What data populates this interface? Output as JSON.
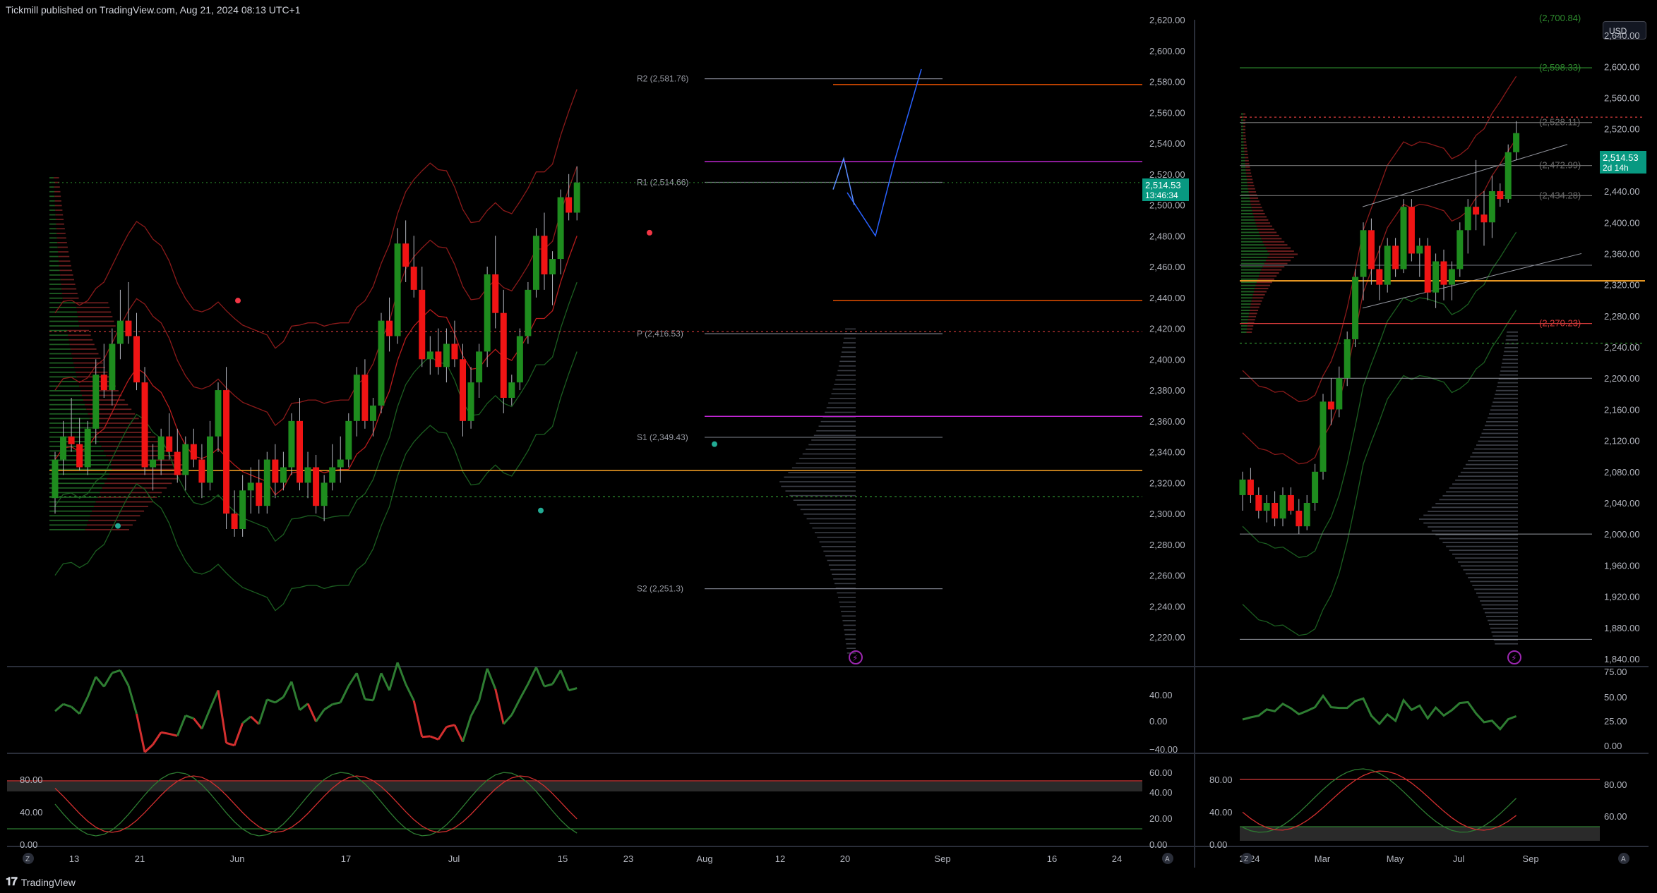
{
  "header": {
    "published": "Tickmill published on TradingView.com, Aug 21, 2024 08:13 UTC+1"
  },
  "footer": {
    "brand": "TradingView"
  },
  "currency_button": "USD",
  "left_chart": {
    "price_ticks": [
      "2,620.00",
      "2,600.00",
      "2,580.00",
      "2,560.00",
      "2,540.00",
      "2,520.00",
      "2,500.00",
      "2,480.00",
      "2,460.00",
      "2,440.00",
      "2,420.00",
      "2,400.00",
      "2,380.00",
      "2,360.00",
      "2,340.00",
      "2,320.00",
      "2,300.00",
      "2,280.00",
      "2,260.00",
      "2,240.00",
      "2,220.00"
    ],
    "price_label": "2,514.53",
    "countdown": "13:46:34",
    "pivots": [
      {
        "label": "R2 (2,581.76)",
        "price": 2581.76
      },
      {
        "label": "R1 (2,514.66)",
        "price": 2514.66
      },
      {
        "label": "P (2,416.53)",
        "price": 2416.53
      },
      {
        "label": "S1 (2,349.43)",
        "price": 2349.43
      },
      {
        "label": "S2 (2,251.3)",
        "price": 2251.3
      }
    ],
    "date_ticks": [
      "13",
      "21",
      "Jun",
      "17",
      "Jul",
      "15",
      "23",
      "Aug",
      "12",
      "20",
      "Sep",
      "16",
      "24"
    ],
    "rsi_ticks": [
      "40.00",
      "0.00",
      "−40.00"
    ],
    "stoch_left_ticks": [
      "80.00",
      "40.00",
      "0.00"
    ],
    "stoch_right_ticks": [
      "60.00",
      "40.00",
      "20.00",
      "0.00"
    ],
    "candles": [
      [
        2310,
        2340,
        2300,
        2335
      ],
      [
        2335,
        2360,
        2325,
        2350
      ],
      [
        2350,
        2375,
        2340,
        2345
      ],
      [
        2345,
        2362,
        2328,
        2330
      ],
      [
        2330,
        2360,
        2325,
        2355
      ],
      [
        2355,
        2400,
        2345,
        2390
      ],
      [
        2390,
        2410,
        2375,
        2380
      ],
      [
        2380,
        2420,
        2370,
        2410
      ],
      [
        2410,
        2445,
        2400,
        2425
      ],
      [
        2425,
        2450,
        2410,
        2415
      ],
      [
        2415,
        2430,
        2380,
        2385
      ],
      [
        2385,
        2395,
        2325,
        2330
      ],
      [
        2330,
        2345,
        2315,
        2335
      ],
      [
        2335,
        2355,
        2325,
        2350
      ],
      [
        2350,
        2365,
        2335,
        2340
      ],
      [
        2340,
        2355,
        2320,
        2325
      ],
      [
        2325,
        2350,
        2315,
        2345
      ],
      [
        2345,
        2355,
        2330,
        2335
      ],
      [
        2335,
        2345,
        2310,
        2320
      ],
      [
        2320,
        2360,
        2315,
        2350
      ],
      [
        2350,
        2385,
        2340,
        2380
      ],
      [
        2380,
        2395,
        2290,
        2300
      ],
      [
        2300,
        2315,
        2285,
        2290
      ],
      [
        2290,
        2325,
        2285,
        2315
      ],
      [
        2315,
        2330,
        2300,
        2320
      ],
      [
        2320,
        2335,
        2300,
        2305
      ],
      [
        2305,
        2340,
        2300,
        2335
      ],
      [
        2335,
        2345,
        2310,
        2320
      ],
      [
        2320,
        2340,
        2315,
        2330
      ],
      [
        2330,
        2365,
        2325,
        2360
      ],
      [
        2360,
        2375,
        2315,
        2320
      ],
      [
        2320,
        2340,
        2310,
        2330
      ],
      [
        2330,
        2338,
        2300,
        2305
      ],
      [
        2305,
        2325,
        2295,
        2320
      ],
      [
        2320,
        2345,
        2315,
        2330
      ],
      [
        2330,
        2350,
        2320,
        2335
      ],
      [
        2335,
        2365,
        2330,
        2360
      ],
      [
        2360,
        2395,
        2350,
        2390
      ],
      [
        2390,
        2400,
        2355,
        2360
      ],
      [
        2360,
        2375,
        2350,
        2370
      ],
      [
        2370,
        2430,
        2365,
        2425
      ],
      [
        2425,
        2440,
        2405,
        2415
      ],
      [
        2415,
        2485,
        2410,
        2475
      ],
      [
        2475,
        2490,
        2450,
        2460
      ],
      [
        2460,
        2480,
        2440,
        2445
      ],
      [
        2445,
        2460,
        2395,
        2400
      ],
      [
        2400,
        2415,
        2390,
        2405
      ],
      [
        2405,
        2420,
        2390,
        2395
      ],
      [
        2395,
        2420,
        2385,
        2410
      ],
      [
        2410,
        2425,
        2395,
        2400
      ],
      [
        2400,
        2410,
        2350,
        2360
      ],
      [
        2360,
        2395,
        2355,
        2385
      ],
      [
        2385,
        2410,
        2375,
        2405
      ],
      [
        2405,
        2460,
        2395,
        2455
      ],
      [
        2455,
        2480,
        2420,
        2430
      ],
      [
        2430,
        2445,
        2365,
        2375
      ],
      [
        2375,
        2390,
        2370,
        2385
      ],
      [
        2385,
        2420,
        2380,
        2415
      ],
      [
        2415,
        2450,
        2410,
        2445
      ],
      [
        2445,
        2485,
        2440,
        2480
      ],
      [
        2480,
        2495,
        2445,
        2455
      ],
      [
        2455,
        2470,
        2435,
        2465
      ],
      [
        2465,
        2510,
        2455,
        2505
      ],
      [
        2505,
        2520,
        2490,
        2495
      ],
      [
        2495,
        2525,
        2490,
        2514.53
      ]
    ]
  },
  "right_chart": {
    "price_ticks": [
      "2,640.00",
      "2,600.00",
      "2,560.00",
      "2,520.00",
      "2,480.00",
      "2,440.00",
      "2,400.00",
      "2,360.00",
      "2,320.00",
      "2,280.00",
      "2,240.00",
      "2,200.00",
      "2,160.00",
      "2,120.00",
      "2,080.00",
      "2,040.00",
      "2,000.00",
      "1,960.00",
      "1,920.00",
      "1,880.00",
      "1,840.00"
    ],
    "price_label": "2,514.53",
    "countdown": "2d 14h",
    "levels": [
      {
        "label": "(2,598.33)",
        "price": 2598.33,
        "color": "#2e8b2e"
      },
      {
        "label": "(2,528.11)",
        "price": 2528.11,
        "color": "#6b6b6b"
      },
      {
        "label": "(2,472.99)",
        "price": 2472.99,
        "color": "#6b6b6b"
      },
      {
        "label": "(2,434.28)",
        "price": 2434.28,
        "color": "#6b6b6b"
      },
      {
        "label": "(2,270.23)",
        "price": 2270.23,
        "color": "#d63b3b"
      }
    ],
    "top_level_label": "(2,700.84)",
    "date_ticks": [
      "2024",
      "Mar",
      "May",
      "Jul",
      "Sep"
    ],
    "rsi_ticks": [
      "75.00",
      "50.00",
      "25.00",
      "0.00"
    ],
    "stoch_left_ticks": [
      "80.00",
      "40.00",
      "0.00"
    ],
    "stoch_right_ticks": [
      "80.00",
      "60.00"
    ],
    "candles": [
      [
        2050,
        2080,
        2030,
        2070
      ],
      [
        2070,
        2085,
        2040,
        2050
      ],
      [
        2050,
        2060,
        2020,
        2030
      ],
      [
        2030,
        2050,
        2015,
        2040
      ],
      [
        2040,
        2055,
        2010,
        2020
      ],
      [
        2020,
        2060,
        2010,
        2050
      ],
      [
        2050,
        2060,
        2025,
        2030
      ],
      [
        2030,
        2045,
        2000,
        2010
      ],
      [
        2010,
        2050,
        2005,
        2040
      ],
      [
        2040,
        2090,
        2030,
        2080
      ],
      [
        2080,
        2180,
        2070,
        2170
      ],
      [
        2170,
        2200,
        2140,
        2160
      ],
      [
        2160,
        2215,
        2150,
        2200
      ],
      [
        2200,
        2260,
        2190,
        2250
      ],
      [
        2250,
        2340,
        2240,
        2330
      ],
      [
        2330,
        2400,
        2300,
        2390
      ],
      [
        2390,
        2405,
        2320,
        2340
      ],
      [
        2340,
        2370,
        2300,
        2320
      ],
      [
        2320,
        2380,
        2310,
        2370
      ],
      [
        2370,
        2380,
        2330,
        2340
      ],
      [
        2340,
        2430,
        2335,
        2420
      ],
      [
        2420,
        2430,
        2350,
        2360
      ],
      [
        2360,
        2380,
        2330,
        2370
      ],
      [
        2370,
        2380,
        2300,
        2310
      ],
      [
        2310,
        2360,
        2290,
        2350
      ],
      [
        2350,
        2365,
        2300,
        2320
      ],
      [
        2320,
        2350,
        2300,
        2340
      ],
      [
        2340,
        2400,
        2330,
        2390
      ],
      [
        2390,
        2430,
        2360,
        2420
      ],
      [
        2420,
        2480,
        2390,
        2410
      ],
      [
        2410,
        2440,
        2370,
        2400
      ],
      [
        2400,
        2460,
        2380,
        2440
      ],
      [
        2440,
        2450,
        2420,
        2430
      ],
      [
        2430,
        2500,
        2425,
        2490
      ],
      [
        2490,
        2530,
        2480,
        2514.53
      ]
    ]
  }
}
